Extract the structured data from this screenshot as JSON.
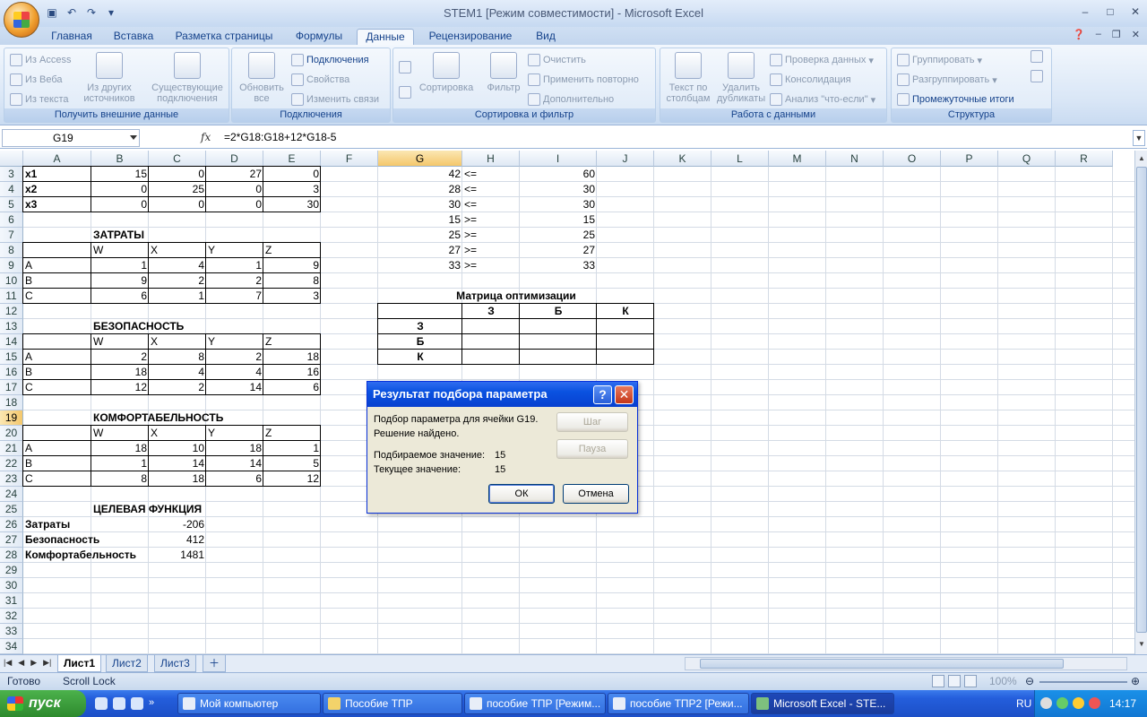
{
  "window": {
    "title": "STEM1  [Режим совместимости] - Microsoft Excel"
  },
  "tabs": [
    "Главная",
    "Вставка",
    "Разметка страницы",
    "Формулы",
    "Данные",
    "Рецензирование",
    "Вид"
  ],
  "active_tab": "Данные",
  "ribbon": {
    "get_external": {
      "label": "Получить внешние данные",
      "from_access": "Из Access",
      "from_web": "Из Веба",
      "from_text": "Из текста",
      "from_other_1": "Из других",
      "from_other_2": "источников",
      "existing_1": "Существующие",
      "existing_2": "подключения"
    },
    "connections": {
      "label": "Подключения",
      "refresh_1": "Обновить",
      "refresh_2": "все",
      "connections": "Подключения",
      "properties": "Свойства",
      "edit_links": "Изменить связи"
    },
    "sort_filter": {
      "label": "Сортировка и фильтр",
      "sort": "Сортировка",
      "filter": "Фильтр",
      "clear": "Очистить",
      "reapply": "Применить повторно",
      "advanced": "Дополнительно"
    },
    "data_tools": {
      "label": "Работа с данными",
      "text_to_cols_1": "Текст по",
      "text_to_cols_2": "столбцам",
      "remove_dup_1": "Удалить",
      "remove_dup_2": "дубликаты",
      "validation": "Проверка данных",
      "consolidate": "Консолидация",
      "what_if": "Анализ \"что-если\""
    },
    "outline": {
      "label": "Структура",
      "group": "Группировать",
      "ungroup": "Разгруппировать",
      "subtotal": "Промежуточные итоги"
    }
  },
  "formula_bar": {
    "name_box": "G19",
    "fx": "fx",
    "formula": "=2*G18:G18+12*G18-5"
  },
  "columns": [
    "A",
    "B",
    "C",
    "D",
    "E",
    "F",
    "G",
    "H",
    "I",
    "J",
    "K",
    "L",
    "M",
    "N",
    "O",
    "P",
    "Q",
    "R"
  ],
  "rows": [
    "3",
    "4",
    "5",
    "6",
    "7",
    "8",
    "9",
    "10",
    "11",
    "12",
    "13",
    "14",
    "15",
    "16",
    "17",
    "18",
    "19",
    "20",
    "21",
    "22",
    "23",
    "24",
    "25",
    "26",
    "27",
    "28",
    "29",
    "30",
    "31",
    "32",
    "33",
    "34"
  ],
  "cells": {
    "A3": "x1",
    "B3": "15",
    "C3": "0",
    "D3": "27",
    "E3": "0",
    "A4": "x2",
    "B4": "0",
    "C4": "25",
    "D4": "0",
    "E4": "3",
    "A5": "x3",
    "B5": "0",
    "C5": "0",
    "D5": "0",
    "E5": "30",
    "B7": "ЗАТРАТЫ",
    "B8": "W",
    "C8": "X",
    "D8": "Y",
    "E8": "Z",
    "A9": "A",
    "B9": "1",
    "C9": "4",
    "D9": "1",
    "E9": "9",
    "A10": "B",
    "B10": "9",
    "C10": "2",
    "D10": "2",
    "E10": "8",
    "A11": "C",
    "B11": "6",
    "C11": "1",
    "D11": "7",
    "E11": "3",
    "B13": "БЕЗОПАСНОСТЬ",
    "B14": "W",
    "C14": "X",
    "D14": "Y",
    "E14": "Z",
    "A15": "A",
    "B15": "2",
    "C15": "8",
    "D15": "2",
    "E15": "18",
    "A16": "B",
    "B16": "18",
    "C16": "4",
    "D16": "4",
    "E16": "16",
    "A17": "C",
    "B17": "12",
    "C17": "2",
    "D17": "14",
    "E17": "6",
    "B19": "КОМФОРТАБЕЛЬНОСТЬ",
    "B20": "W",
    "C20": "X",
    "D20": "Y",
    "E20": "Z",
    "A21": "A",
    "B21": "18",
    "C21": "10",
    "D21": "18",
    "E21": "1",
    "A22": "B",
    "B22": "1",
    "C22": "14",
    "D22": "14",
    "E22": "5",
    "A23": "C",
    "B23": "8",
    "C23": "18",
    "D23": "6",
    "E23": "12",
    "B25": "ЦЕЛЕВАЯ ФУНКЦИЯ",
    "A26": "Затраты",
    "C26": "-206",
    "A27": "Безопасность",
    "C27": "412",
    "A28": "Комфортабельность",
    "C28": "1481",
    "G3": "42",
    "H3": "<=",
    "I3": "60",
    "G4": "28",
    "H4": "<=",
    "I4": "30",
    "G5": "30",
    "H5": "<=",
    "I5": "30",
    "G6": "15",
    "H6": ">=",
    "I6": "15",
    "G7": "25",
    "H7": ">=",
    "I7": "25",
    "G8": "27",
    "H8": ">=",
    "I8": "27",
    "G9": "33",
    "H9": ">=",
    "I9": "33",
    "H11": "Матрица оптимизации",
    "H12": "З",
    "I12": "Б",
    "J12": "К",
    "G13": "З",
    "G14": "Б",
    "G15": "К"
  },
  "sheets": [
    "Лист1",
    "Лист2",
    "Лист3"
  ],
  "active_sheet": "Лист1",
  "status": {
    "ready": "Готово",
    "scroll_lock": "Scroll Lock",
    "zoom": "100%"
  },
  "dialog": {
    "title": "Результат подбора параметра",
    "line1": "Подбор параметра для ячейки G19.",
    "line2": "Решение найдено.",
    "target_label": "Подбираемое значение:",
    "target_value": "15",
    "current_label": "Текущее значение:",
    "current_value": "15",
    "step": "Шаг",
    "pause": "Пауза",
    "ok": "ОК",
    "cancel": "Отмена",
    "help": "?",
    "close": "✕"
  },
  "taskbar": {
    "start": "пуск",
    "items": [
      "Мой компьютер",
      "Пособие ТПР",
      "пособие ТПР [Режим...",
      "пособие ТПР2 [Режи...",
      "Microsoft Excel - STE..."
    ],
    "active_item": 4,
    "lang": "RU",
    "clock": "14:17"
  }
}
